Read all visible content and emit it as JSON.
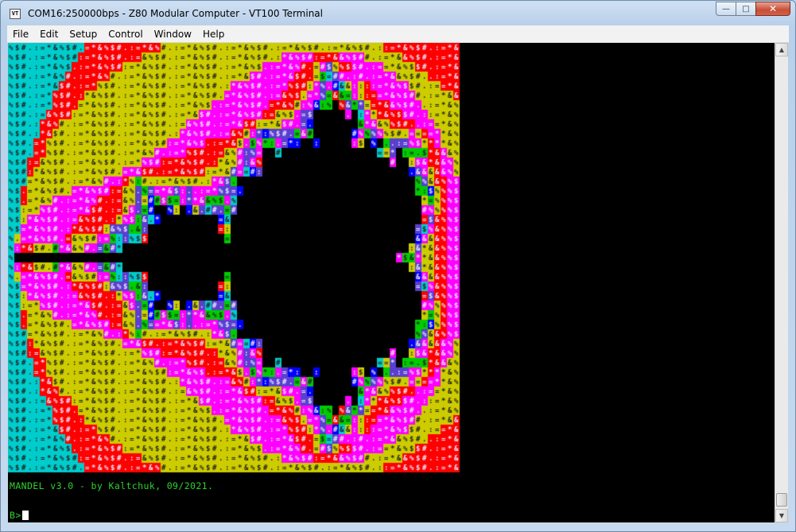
{
  "window": {
    "title": "COM16:250000bps - Z80 Modular Computer - VT100 Terminal",
    "app_icon_text": "VT",
    "minimize_label": "—",
    "maximize_label": "□",
    "close_label": "✕"
  },
  "menu": {
    "items": [
      {
        "label": "File"
      },
      {
        "label": "Edit"
      },
      {
        "label": "Setup"
      },
      {
        "label": "Control"
      },
      {
        "label": "Window"
      },
      {
        "label": "Help"
      }
    ]
  },
  "terminal": {
    "credit_line": "MANDEL v3.0 - by Kaltchuk, 09/2021.",
    "prompt": "B>",
    "text_color": "#2fd12f",
    "background": "#000000",
    "palette": [
      "#0000ff",
      "#ff0000",
      "#ff00ff",
      "#00cc00",
      "#00cccc",
      "#cccc00",
      "#5a3fd0"
    ],
    "glyphs": [
      "&",
      "%",
      "$",
      "#",
      ".",
      ":",
      "=",
      "*"
    ]
  },
  "scrollbar": {
    "up_arrow": "▲",
    "down_arrow": "▼"
  }
}
